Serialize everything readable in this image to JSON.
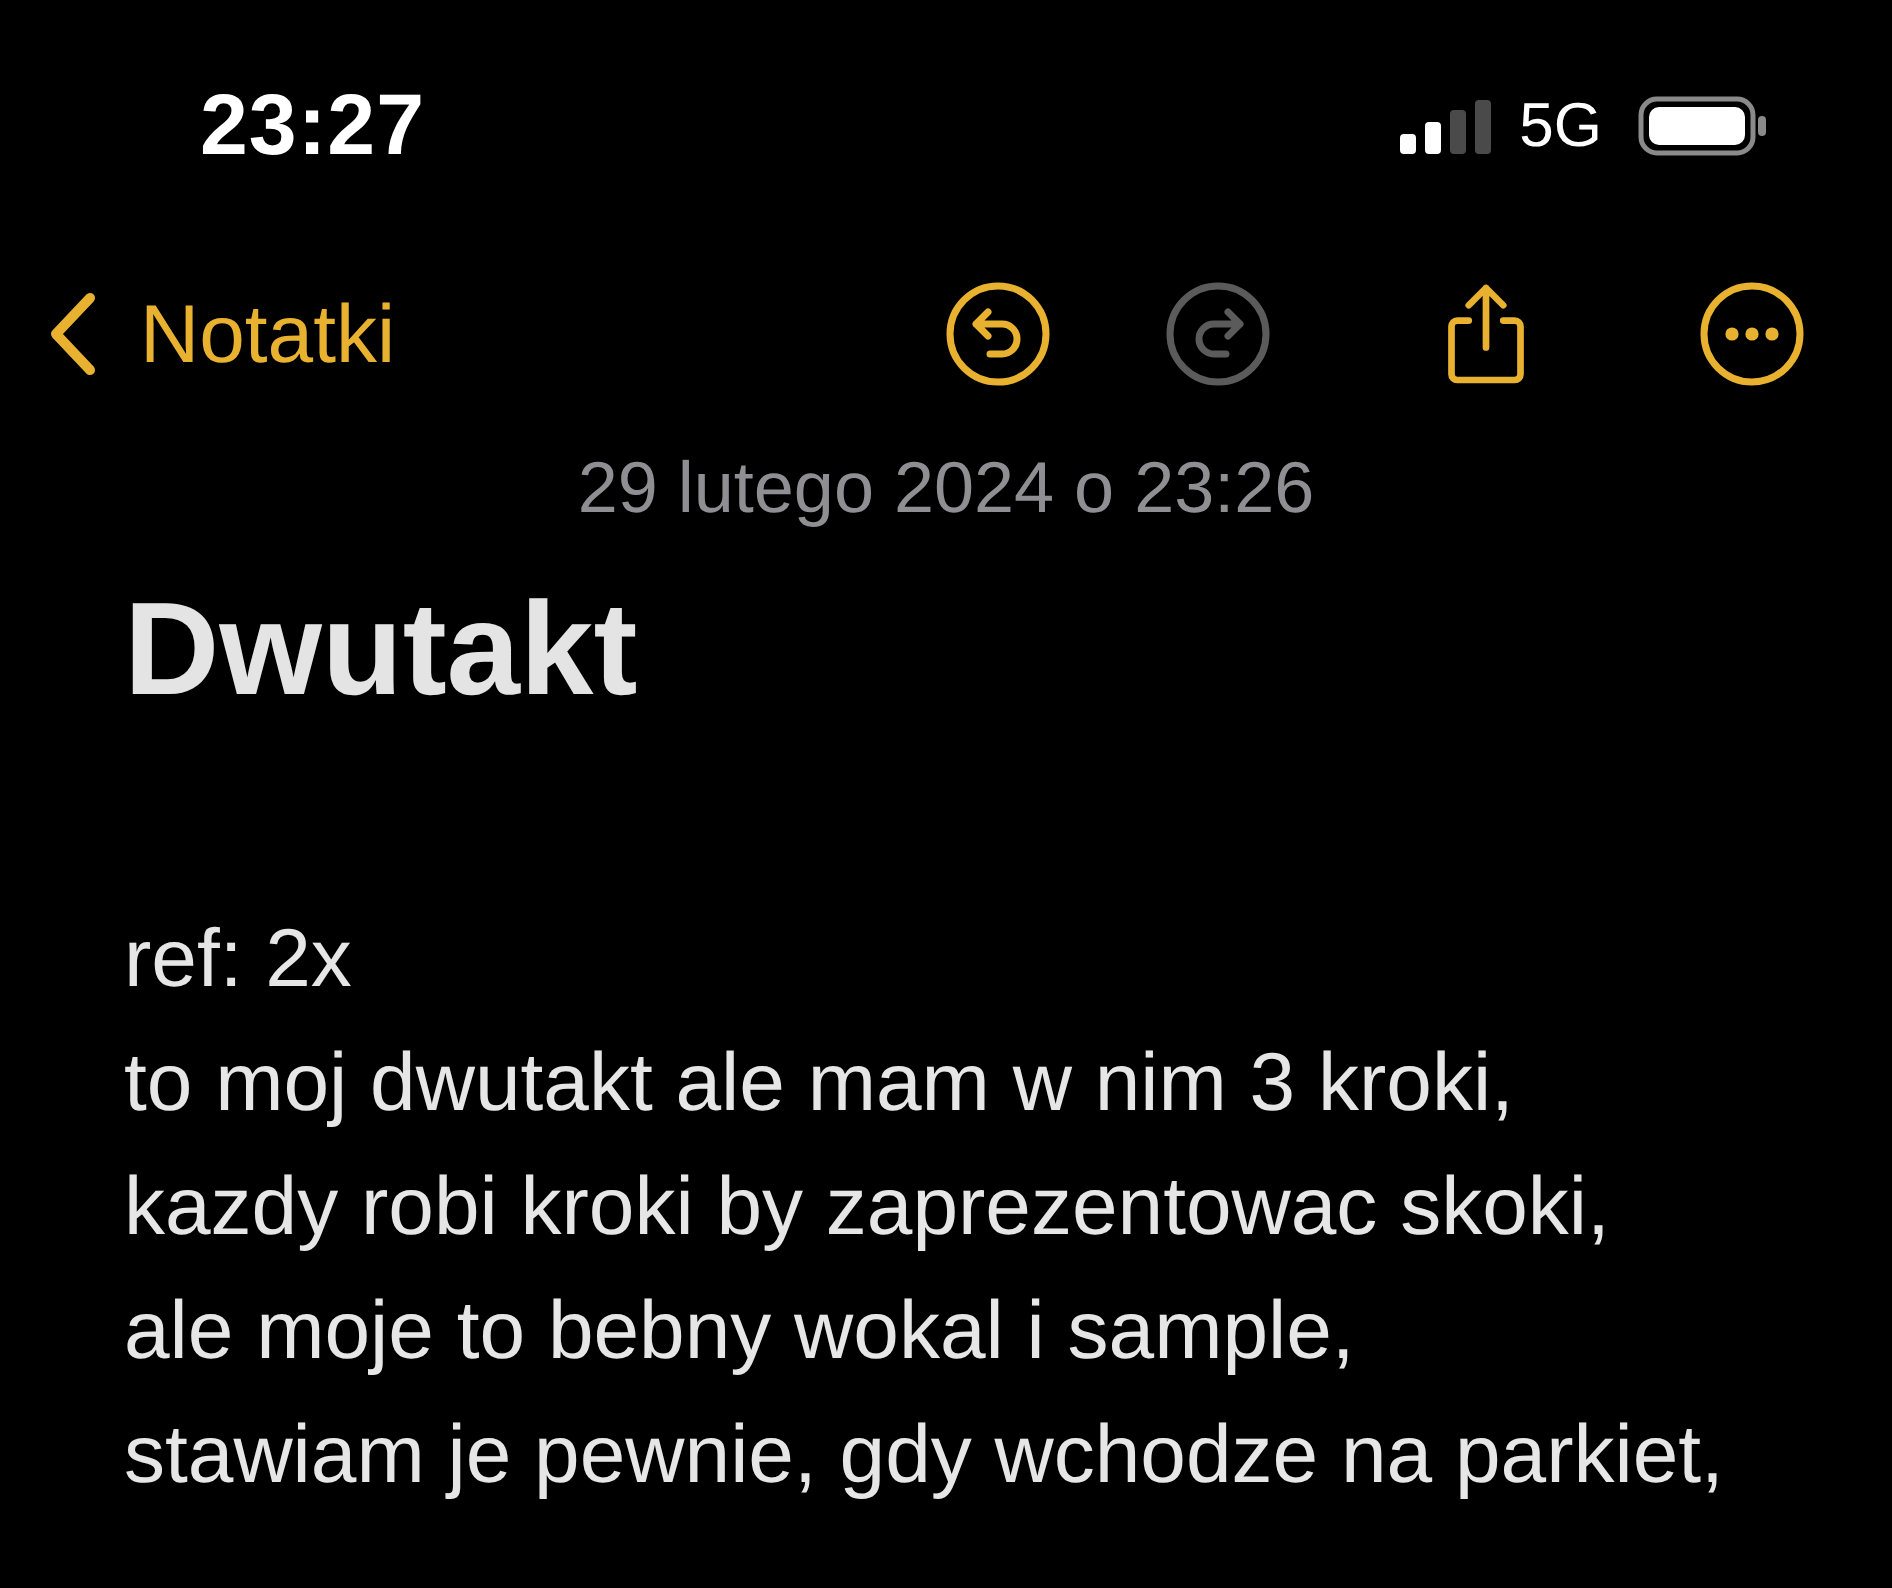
{
  "status_bar": {
    "time": "23:27",
    "network": "5G"
  },
  "nav_bar": {
    "back_label": "Notatki",
    "actions": [
      {
        "kind": "undo",
        "disabled": false
      },
      {
        "kind": "redo",
        "disabled": true
      },
      {
        "kind": "share",
        "disabled": false
      },
      {
        "kind": "more",
        "disabled": false
      }
    ]
  },
  "note": {
    "date": "29 lutego 2024 o 23:26",
    "title": "Dwutakt",
    "lines": [
      "ref: 2x",
      "to moj dwutakt ale mam w nim 3 kroki,",
      "kazdy robi kroki by zaprezentowac skoki,",
      "ale moje to bebny wokal i sample,",
      "stawiam je pewnie, gdy wchodze na parkiet,"
    ]
  }
}
